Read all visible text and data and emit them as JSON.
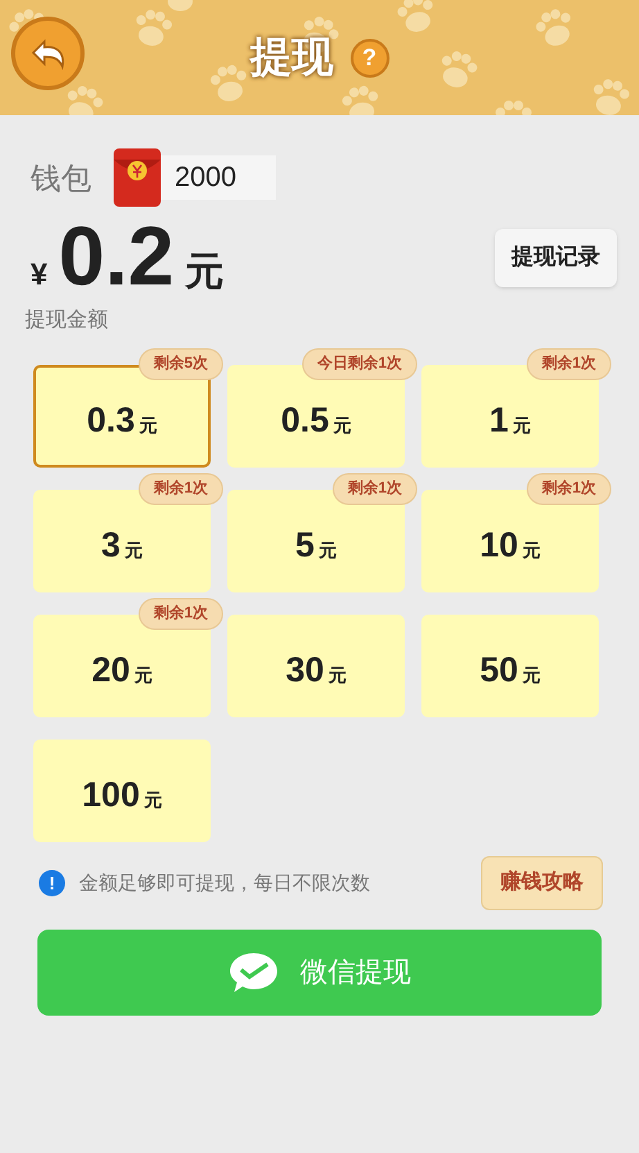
{
  "header": {
    "title": "提现",
    "help": "?"
  },
  "wallet": {
    "label": "钱包",
    "balance": "2000"
  },
  "amount": {
    "currency": "¥",
    "value": "0.2",
    "unit": "元",
    "label": "提现金额"
  },
  "record_button": "提现记录",
  "options": [
    {
      "amount": "0.3",
      "unit": "元",
      "badge": "剩余5次",
      "selected": true
    },
    {
      "amount": "0.5",
      "unit": "元",
      "badge": "今日剩余1次",
      "selected": false
    },
    {
      "amount": "1",
      "unit": "元",
      "badge": "剩余1次",
      "selected": false
    },
    {
      "amount": "3",
      "unit": "元",
      "badge": "剩余1次",
      "selected": false
    },
    {
      "amount": "5",
      "unit": "元",
      "badge": "剩余1次",
      "selected": false
    },
    {
      "amount": "10",
      "unit": "元",
      "badge": "剩余1次",
      "selected": false
    },
    {
      "amount": "20",
      "unit": "元",
      "badge": "剩余1次",
      "selected": false
    },
    {
      "amount": "30",
      "unit": "元",
      "selected": false
    },
    {
      "amount": "50",
      "unit": "元",
      "selected": false
    },
    {
      "amount": "100",
      "unit": "元",
      "selected": false
    }
  ],
  "notice": {
    "icon": "!",
    "text": "金额足够即可提现，每日不限次数"
  },
  "guide_button": "赚钱攻略",
  "withdraw_button": "微信提现"
}
